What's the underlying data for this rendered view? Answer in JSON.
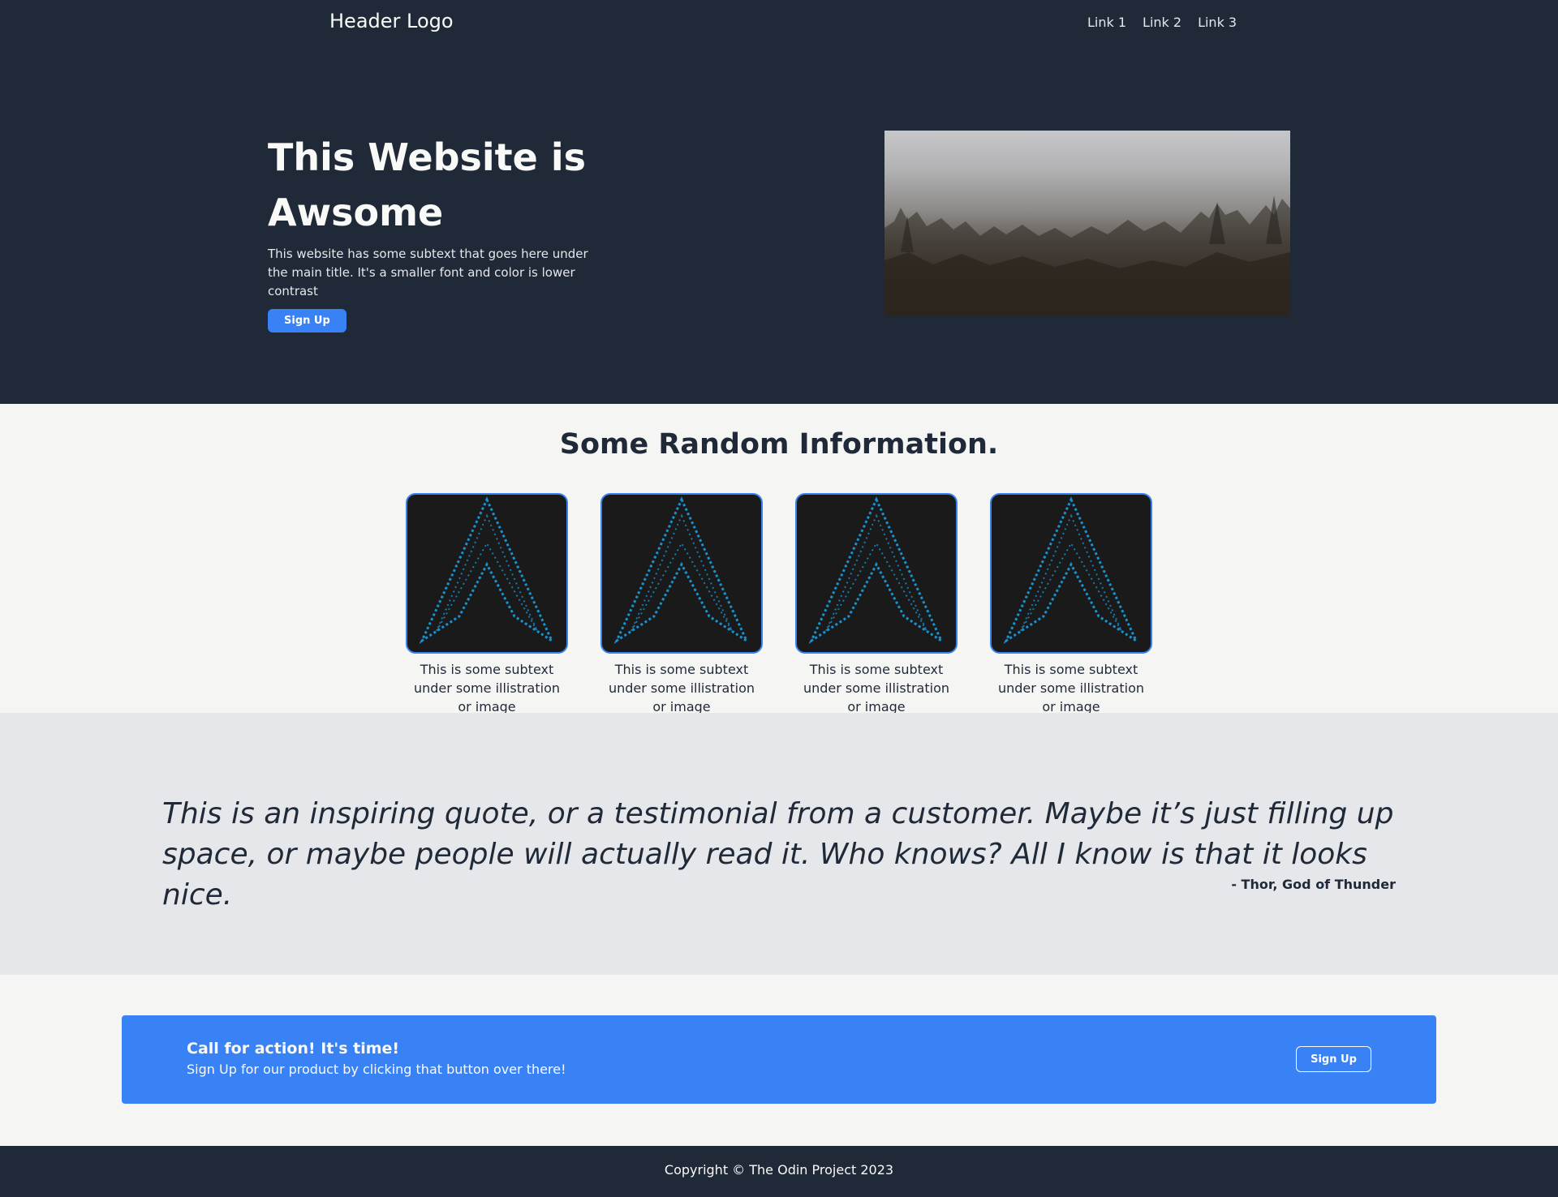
{
  "header": {
    "logo": "Header Logo",
    "links": [
      "Link 1",
      "Link 2",
      "Link 3"
    ]
  },
  "hero": {
    "title": "This Website is Awsome",
    "subtext": "This website has some subtext that goes here under the main title. It's a smaller font and color is lower contrast",
    "button_label": "Sign Up"
  },
  "info": {
    "title": "Some Random Information.",
    "cards": [
      {
        "caption": "This is some subtext under some illistration or image"
      },
      {
        "caption": "This is some subtext under some illistration or image"
      },
      {
        "caption": "This is some subtext under some illistration or image"
      },
      {
        "caption": "This is some subtext under some illistration or image"
      }
    ]
  },
  "quote": {
    "text": "This is an inspiring quote, or a testimonial from a customer. Maybe it’s just filling up space, or maybe people will actually read it. Who knows? All I know is that it looks nice.",
    "author": "- Thor, God of Thunder"
  },
  "cta": {
    "title": "Call for action! It's time!",
    "subtext": "Sign Up for our product by clicking that button over there!",
    "button_label": "Sign Up"
  },
  "footer": {
    "copyright": "Copyright © The Odin Project 2023"
  },
  "colors": {
    "dark": "#1f2937",
    "accent": "#3882f6",
    "light_bg": "#f5f5f4",
    "quote_bg": "#e5e7eb",
    "ascii_logo": "#1793d1"
  },
  "icons": {
    "card_image": "arch-linux-ascii-logo"
  }
}
